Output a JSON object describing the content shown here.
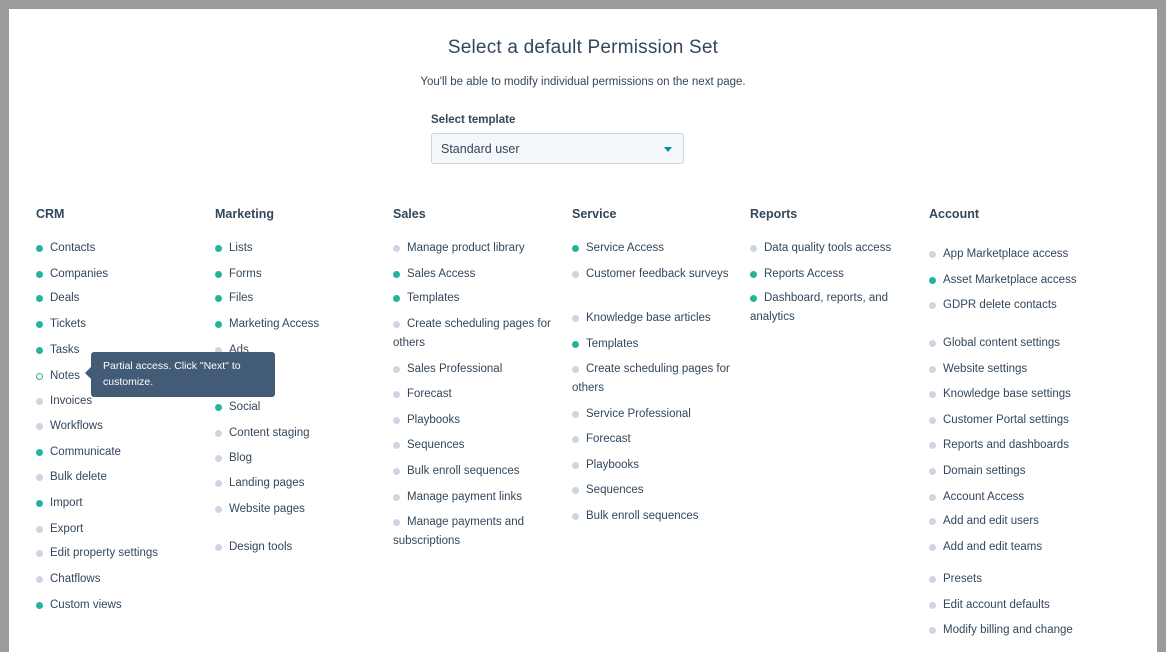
{
  "header": {
    "title": "Select a default Permission Set",
    "subtitle": "You'll be able to modify individual permissions on the next page."
  },
  "template": {
    "label": "Select template",
    "value": "Standard user"
  },
  "tooltip": {
    "text": "Partial access. Click \"Next\" to customize."
  },
  "columns": [
    {
      "title": "CRM",
      "items": [
        {
          "label": "Contacts",
          "status": "full"
        },
        {
          "label": "Companies",
          "status": "full"
        },
        {
          "label": "Deals",
          "status": "full"
        },
        {
          "label": "Tickets",
          "status": "full"
        },
        {
          "label": "Tasks",
          "status": "full"
        },
        {
          "label": "Notes",
          "status": "partial"
        },
        {
          "label": "Invoices",
          "status": "none"
        },
        {
          "label": "Workflows",
          "status": "none"
        },
        {
          "label": "Communicate",
          "status": "full"
        },
        {
          "label": "Bulk delete",
          "status": "none"
        },
        {
          "label": "Import",
          "status": "full"
        },
        {
          "label": "Export",
          "status": "none"
        },
        {
          "label": "Edit property settings",
          "status": "none"
        },
        {
          "label": "Chatflows",
          "status": "none"
        },
        {
          "label": "Custom views",
          "status": "full"
        }
      ]
    },
    {
      "title": "Marketing",
      "items": [
        {
          "label": "Lists",
          "status": "full"
        },
        {
          "label": "Forms",
          "status": "full"
        },
        {
          "label": "Files",
          "status": "full"
        },
        {
          "label": "Marketing Access",
          "status": "full"
        },
        {
          "label": "Ads",
          "status": "none"
        },
        {
          "label": "",
          "status": "none"
        },
        {
          "label": "Social",
          "status": "full"
        },
        {
          "label": "Content staging",
          "status": "none"
        },
        {
          "label": "Blog",
          "status": "none"
        },
        {
          "label": "Landing pages",
          "status": "none"
        },
        {
          "label": "Website pages",
          "status": "none"
        },
        {
          "label": "Design tools",
          "status": "none"
        }
      ]
    },
    {
      "title": "Sales",
      "items": [
        {
          "label": "Manage product library",
          "status": "none"
        },
        {
          "label": "Sales Access",
          "status": "full"
        },
        {
          "label": "Templates",
          "status": "full"
        },
        {
          "label": "Create scheduling pages for others",
          "status": "none"
        },
        {
          "label": "Sales Professional",
          "status": "none"
        },
        {
          "label": "Forecast",
          "status": "none"
        },
        {
          "label": "Playbooks",
          "status": "none"
        },
        {
          "label": "Sequences",
          "status": "none"
        },
        {
          "label": "Bulk enroll sequences",
          "status": "none"
        },
        {
          "label": "Manage payment links",
          "status": "none"
        },
        {
          "label": "Manage payments and subscriptions",
          "status": "none"
        }
      ]
    },
    {
      "title": "Service",
      "items": [
        {
          "label": "Service Access",
          "status": "full"
        },
        {
          "label": "Customer feedback surveys",
          "status": "none"
        },
        {
          "label": "Knowledge base articles",
          "status": "none"
        },
        {
          "label": "Templates",
          "status": "full"
        },
        {
          "label": "Create scheduling pages for others",
          "status": "none"
        },
        {
          "label": "Service Professional",
          "status": "none"
        },
        {
          "label": "Forecast",
          "status": "none"
        },
        {
          "label": "Playbooks",
          "status": "none"
        },
        {
          "label": "Sequences",
          "status": "none"
        },
        {
          "label": "Bulk enroll sequences",
          "status": "none"
        }
      ]
    },
    {
      "title": "Reports",
      "items": [
        {
          "label": "Data quality tools access",
          "status": "none"
        },
        {
          "label": "Reports Access",
          "status": "full"
        },
        {
          "label": "Dashboard, reports, and analytics",
          "status": "full"
        }
      ]
    },
    {
      "title": "Account",
      "items": [
        {
          "label": "App Marketplace access",
          "status": "none"
        },
        {
          "label": "Asset Marketplace access",
          "status": "full"
        },
        {
          "label": "GDPR delete contacts",
          "status": "none"
        },
        {
          "label": "Global content settings",
          "status": "none"
        },
        {
          "label": "Website settings",
          "status": "none"
        },
        {
          "label": "Knowledge base settings",
          "status": "none"
        },
        {
          "label": "Customer Portal settings",
          "status": "none"
        },
        {
          "label": "Reports and dashboards",
          "status": "none"
        },
        {
          "label": "Domain settings",
          "status": "none"
        },
        {
          "label": "Account Access",
          "status": "none"
        },
        {
          "label": "Add and edit users",
          "status": "none"
        },
        {
          "label": "Add and edit teams",
          "status": "none"
        },
        {
          "label": "Presets",
          "status": "none"
        },
        {
          "label": "Edit account defaults",
          "status": "none"
        },
        {
          "label": "Modify billing and change",
          "status": "none"
        }
      ]
    }
  ],
  "colors": {
    "full_access": "#25b399",
    "no_access": "#cbd6e2",
    "text": "#33475b",
    "tooltip_bg": "#425b76",
    "accent": "#0091ae"
  }
}
